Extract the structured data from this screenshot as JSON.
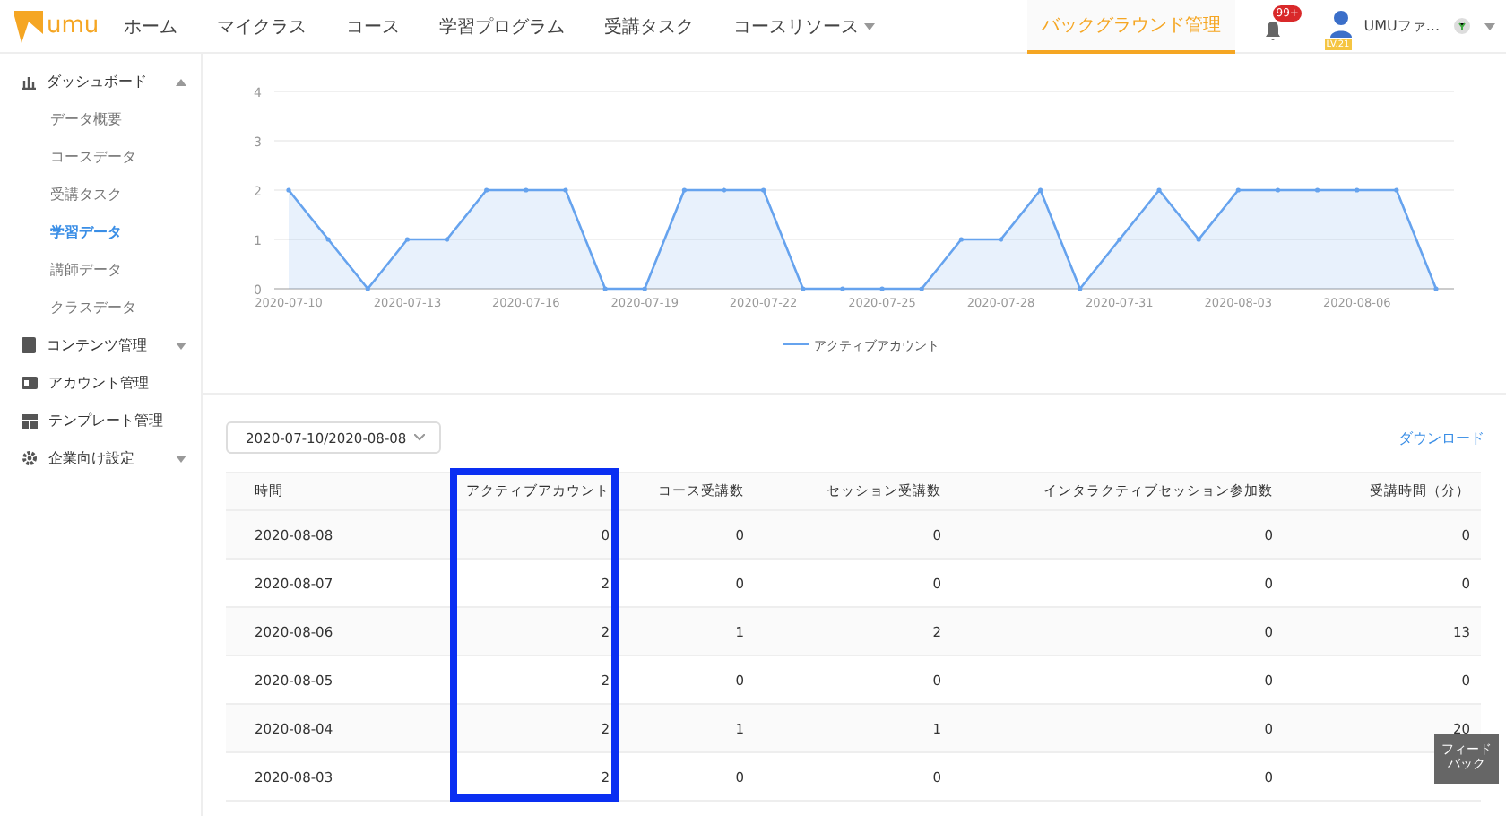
{
  "header": {
    "logo": "umu",
    "nav": [
      {
        "label": "ホーム",
        "selected": false,
        "dropdown": false
      },
      {
        "label": "マイクラス",
        "selected": false,
        "dropdown": false
      },
      {
        "label": "コース",
        "selected": false,
        "dropdown": false
      },
      {
        "label": "学習プログラム",
        "selected": false,
        "dropdown": false
      },
      {
        "label": "受講タスク",
        "selected": false,
        "dropdown": false
      },
      {
        "label": "コースリソース",
        "selected": false,
        "dropdown": true
      }
    ],
    "admin_tab": {
      "label": "バックグラウンド管理",
      "selected": true
    },
    "notifications": "99+",
    "level_badge": "LV.21",
    "user_name": "UMUファ..."
  },
  "sidebar": {
    "items": [
      {
        "label": "ダッシュボード",
        "expanded": true,
        "caret": true,
        "children": [
          {
            "label": "データ概要",
            "selected": false
          },
          {
            "label": "コースデータ",
            "selected": false
          },
          {
            "label": "受講タスク",
            "selected": false
          },
          {
            "label": "学習データ",
            "selected": true
          },
          {
            "label": "講師データ",
            "selected": false
          },
          {
            "label": "クラスデータ",
            "selected": false
          }
        ]
      },
      {
        "label": "コンテンツ管理",
        "expanded": false,
        "caret": true
      },
      {
        "label": "アカウント管理",
        "caret": false
      },
      {
        "label": "テンプレート管理",
        "caret": false
      },
      {
        "label": "企業向け設定",
        "expanded": false,
        "caret": true
      }
    ]
  },
  "chart": {
    "chart_data": {
      "type": "area",
      "grid": true,
      "categories": [
        "2020-07-10",
        null,
        null,
        "2020-07-13",
        null,
        null,
        "2020-07-16",
        null,
        null,
        "2020-07-19",
        null,
        null,
        "2020-07-22",
        null,
        null,
        "2020-07-25",
        null,
        null,
        "2020-07-28",
        null,
        null,
        "2020-07-31",
        null,
        null,
        "2020-08-03",
        null,
        null,
        "2020-08-06",
        null,
        null
      ],
      "series": [
        {
          "name": "アクティブアカウント",
          "color": "#66a3ee",
          "values": [
            2,
            1,
            0,
            1,
            1,
            2,
            2,
            2,
            0,
            0,
            2,
            2,
            2,
            0,
            0,
            0,
            0,
            1,
            1,
            2,
            0,
            1,
            2,
            1,
            2,
            2,
            2,
            2,
            2,
            0
          ]
        }
      ],
      "ylim": [
        0,
        4
      ],
      "yticks": [
        0,
        1,
        2,
        3,
        4
      ]
    }
  },
  "date_range": "2020-07-10/2020-08-08",
  "download": "ダウンロード",
  "table": {
    "columns": [
      {
        "label": "時間",
        "highlighted": false
      },
      {
        "label": "アクティブアカウント",
        "highlighted": true
      },
      {
        "label": "コース受講数",
        "highlighted": false
      },
      {
        "label": "セッション受講数",
        "highlighted": false
      },
      {
        "label": "インタラクティブセッション参加数",
        "highlighted": false
      },
      {
        "label": "受講時間（分）",
        "highlighted": false
      }
    ],
    "rows": [
      [
        "2020-08-08",
        "0",
        "0",
        "0",
        "0",
        "0"
      ],
      [
        "2020-08-07",
        "2",
        "0",
        "0",
        "0",
        "0"
      ],
      [
        "2020-08-06",
        "2",
        "1",
        "2",
        "0",
        "13"
      ],
      [
        "2020-08-05",
        "2",
        "0",
        "0",
        "0",
        "0"
      ],
      [
        "2020-08-04",
        "2",
        "1",
        "1",
        "0",
        "20"
      ],
      [
        "2020-08-03",
        "2",
        "0",
        "0",
        "0",
        null
      ]
    ]
  },
  "feedback": "フィードバック"
}
